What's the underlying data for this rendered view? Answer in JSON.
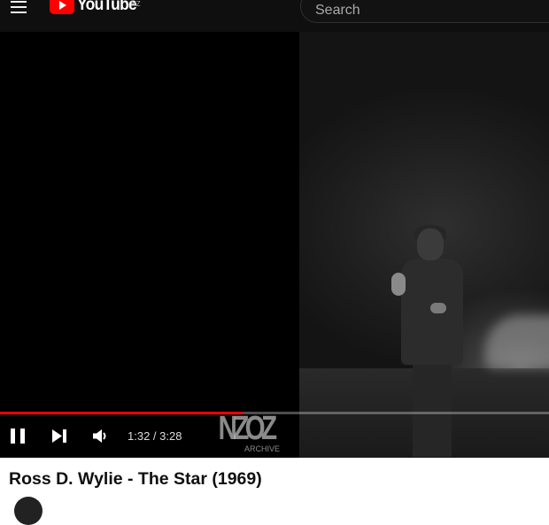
{
  "header": {
    "logo_text": "YouTube",
    "country_code": "NZ",
    "search_placeholder": "Search"
  },
  "player": {
    "current_time": "1:32",
    "separator": " / ",
    "duration": "3:28",
    "progress_fraction": 0.4423,
    "watermark": {
      "logo_text": "NZOZ",
      "sub_text": "ARCHIVE"
    }
  },
  "video": {
    "title": "Ross D. Wylie - The Star (1969)"
  },
  "colors": {
    "topbar": "#0f0f0f",
    "progress": "#ff0000",
    "logo_red": "#ff0000"
  },
  "icons": [
    "menu-icon",
    "youtube-logo-icon",
    "search-icon",
    "pause-icon",
    "next-icon",
    "volume-icon"
  ]
}
